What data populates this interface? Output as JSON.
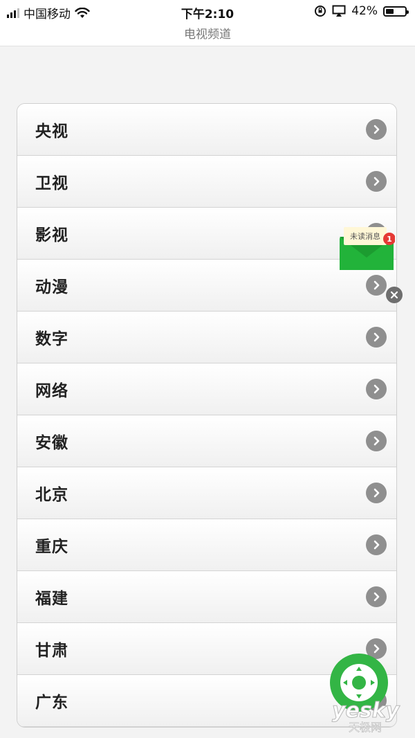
{
  "status_bar": {
    "carrier": "中国移动",
    "time": "下午2:10",
    "battery_percent": "42%",
    "battery_level": 0.42
  },
  "header": {
    "title": "电视频道"
  },
  "channels": [
    {
      "label": "央视"
    },
    {
      "label": "卫视"
    },
    {
      "label": "影视"
    },
    {
      "label": "动漫"
    },
    {
      "label": "数字"
    },
    {
      "label": "网络"
    },
    {
      "label": "安徽"
    },
    {
      "label": "北京"
    },
    {
      "label": "重庆"
    },
    {
      "label": "福建"
    },
    {
      "label": "甘肃"
    },
    {
      "label": "广东"
    }
  ],
  "unread_badge": {
    "text": "未读消息",
    "count": "1"
  },
  "watermark": {
    "brand": "yesky",
    "sub": "天极网"
  },
  "colors": {
    "accent_green": "#22b33a",
    "badge_red": "#e53935",
    "chevron_gray": "#8f8f8f"
  },
  "icons": {
    "chevron": "chevron-right-icon",
    "mail": "envelope-icon",
    "close": "close-icon",
    "remote": "remote-control-icon",
    "wifi": "wifi-icon",
    "signal": "signal-icon",
    "battery": "battery-icon"
  }
}
